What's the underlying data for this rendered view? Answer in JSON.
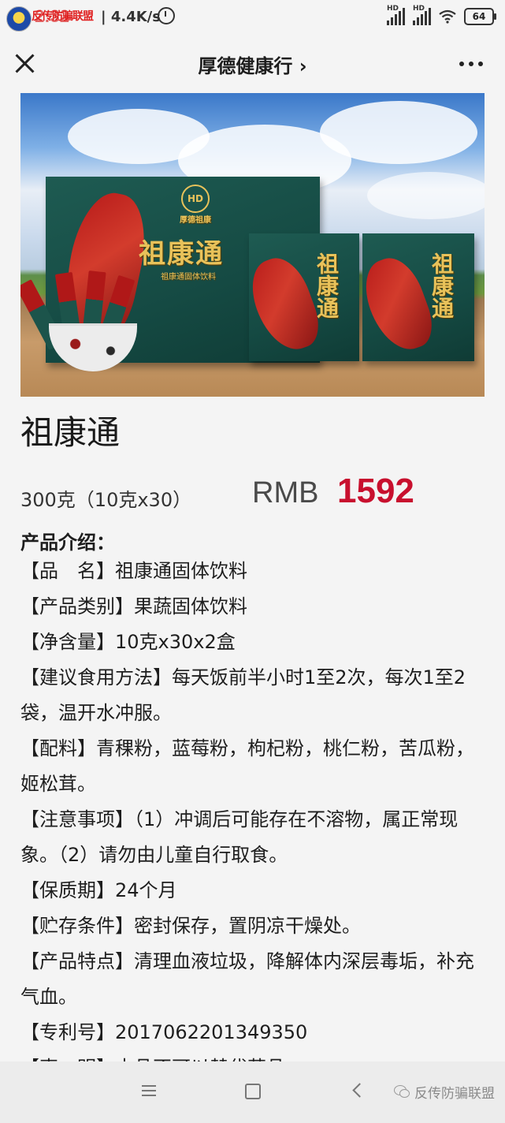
{
  "status_bar": {
    "watermark": "反传防骗联盟",
    "time": "2:32",
    "network_speed": "| 4.4K/s",
    "signal_label_1": "HD",
    "signal_label_2": "HD",
    "battery": "64"
  },
  "nav": {
    "title": "厚德健康行 ›"
  },
  "hero_image": {
    "box_brand": "厚德祖康",
    "product_text_large": "祖康通",
    "product_text_small": "祖康通固体饮料",
    "logo": "HD"
  },
  "product": {
    "name": "祖康通",
    "spec": "300克（10克x30）",
    "currency": "RMB",
    "price": "1592"
  },
  "intro": {
    "heading": "产品介绍：",
    "details": [
      "【品　名】祖康通固体饮料",
      "【产品类别】果蔬固体饮料",
      "【净含量】10克x30x2盒",
      "【建议食用方法】每天饭前半小时1至2次，每次1至2袋，温开水冲服。",
      "【配料】青稞粉，蓝莓粉，枸杞粉，桃仁粉，苦瓜粉，姬松茸。",
      "【注意事项】（1）冲调后可能存在不溶物，属正常现象。（2）请勿由儿童自行取食。",
      "【保质期】24个月",
      "【贮存条件】密封保存，置阴凉干燥处。",
      "【产品特点】清理血液垃圾，降解体内深层毒垢，补充气血。",
      "【专利号】2017062201349350",
      "【声　明】本品不可以替代药品。"
    ]
  },
  "bottom_bar": {
    "watermark": "反传防骗联盟",
    "icons": [
      "menu-icon",
      "home-icon",
      "back-icon",
      "wechat-icon"
    ]
  },
  "colors": {
    "price": "#c8102e",
    "background": "#f4f4f4",
    "box_green": "#1e5b52"
  }
}
